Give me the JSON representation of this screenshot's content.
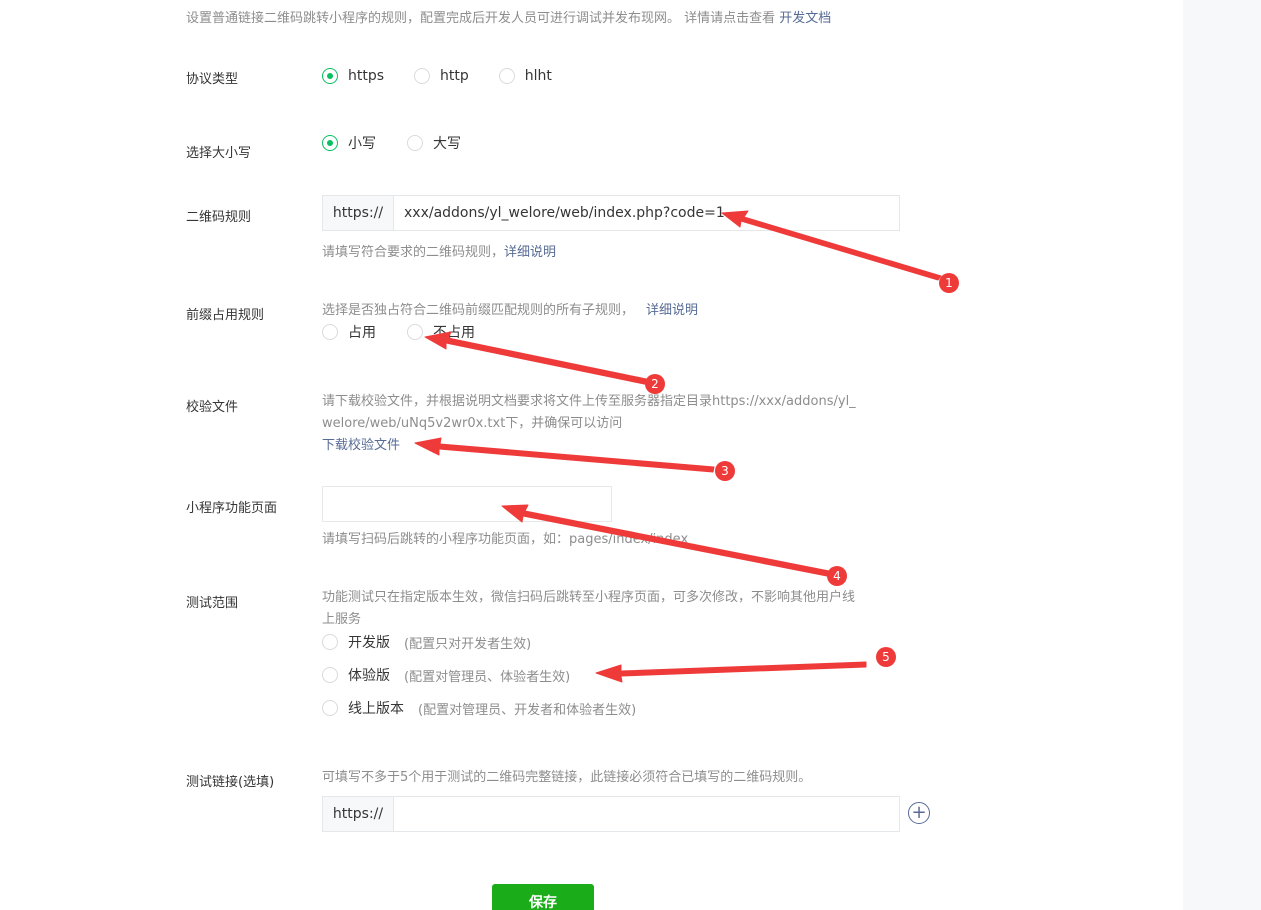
{
  "intro": {
    "text": "设置普通链接二维码跳转小程序的规则，配置完成后开发人员可进行调试并发布现网。 详情请点击查看 ",
    "link": "开发文档"
  },
  "protocol": {
    "label": "协议类型",
    "options": [
      "https",
      "http",
      "hlht"
    ],
    "selected": "https"
  },
  "case": {
    "label": "选择大小写",
    "options": [
      "小写",
      "大写"
    ],
    "selected": "小写"
  },
  "qr_rule": {
    "label": "二维码规则",
    "prefix": "https://",
    "value": "xxx/addons/yl_welore/web/index.php?code=1",
    "hint": "请填写符合要求的二维码规则，",
    "hint_link": "详细说明"
  },
  "prefix_rule": {
    "label": "前缀占用规则",
    "hint": "选择是否独占符合二维码前缀匹配规则的所有子规则，",
    "hint_link": "详细说明",
    "options": [
      "占用",
      "不占用"
    ]
  },
  "verify_file": {
    "label": "校验文件",
    "hint_line1": "请下载校验文件，并根据说明文档要求将文件上传至服务器指定目录https://xxx/addons/yl_",
    "hint_line2": "welore/web/uNq5v2wr0x.txt下，并确保可以访问",
    "download_link": "下载校验文件"
  },
  "page": {
    "label": "小程序功能页面",
    "value": "",
    "hint": "请填写扫码后跳转的小程序功能页面，如：pages/index/index"
  },
  "test_scope": {
    "label": "测试范围",
    "hint_line1": "功能测试只在指定版本生效，微信扫码后跳转至小程序页面，可多次修改，不影响其他用户线",
    "hint_line2": "上服务",
    "options": [
      {
        "name": "开发版",
        "desc": "(配置只对开发者生效)"
      },
      {
        "name": "体验版",
        "desc": "(配置对管理员、体验者生效)"
      },
      {
        "name": "线上版本",
        "desc": "(配置对管理员、开发者和体验者生效)"
      }
    ]
  },
  "test_link": {
    "label": "测试链接(选填)",
    "hint": "可填写不多于5个用于测试的二维码完整链接，此链接必须符合已填写的二维码规则。",
    "prefix": "https://",
    "value": "",
    "add_icon": "plus-circle-icon"
  },
  "save_label": "保存",
  "annotations": [
    "1",
    "2",
    "3",
    "4",
    "5"
  ],
  "colors": {
    "accent": "#07c160",
    "save": "#1aad19",
    "link": "#576b95",
    "annotation": "#ef3a3a"
  }
}
